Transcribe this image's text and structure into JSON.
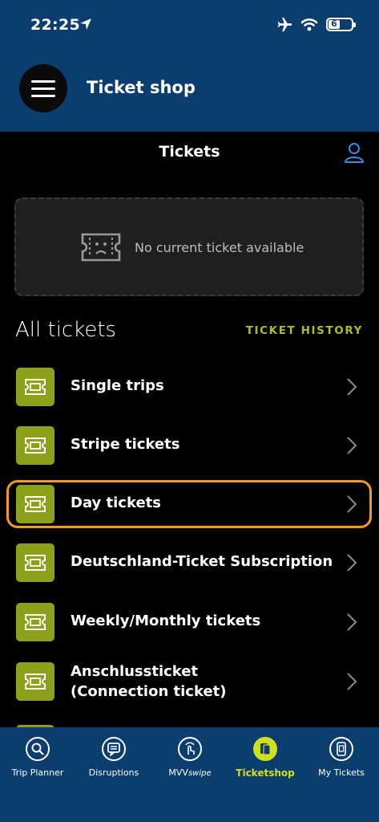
{
  "status_bar": {
    "time": "22:25",
    "battery": "6"
  },
  "header": {
    "title": "Ticket shop"
  },
  "tickets_bar": {
    "title": "Tickets"
  },
  "current_ticket": {
    "message": "No current ticket available"
  },
  "list_header": {
    "title": "All tickets",
    "history_link": "TICKET HISTORY"
  },
  "ticket_categories": [
    {
      "label": "Single trips"
    },
    {
      "label": "Stripe tickets"
    },
    {
      "label": "Day tickets",
      "highlighted": true
    },
    {
      "label": "Deutschland-Ticket Subscription"
    },
    {
      "label": "Weekly/Monthly tickets"
    },
    {
      "label": "Anschlussticket\n(Connection ticket)"
    }
  ],
  "bottom_nav": [
    {
      "label": "Trip Planner",
      "icon": "search-icon"
    },
    {
      "label": "Disruptions",
      "icon": "disruptions-icon"
    },
    {
      "label": "MVV",
      "label_suffix": "swipe",
      "icon": "swipe-icon"
    },
    {
      "label": "Ticketshop",
      "icon": "ticketshop-icon",
      "active": true
    },
    {
      "label": "My Tickets",
      "icon": "my-tickets-icon"
    }
  ],
  "colors": {
    "header_bg": "#0b3d6e",
    "accent_green": "#a6c11d",
    "highlight_orange": "#f39a1c",
    "icon_tile": "#8ca019"
  }
}
